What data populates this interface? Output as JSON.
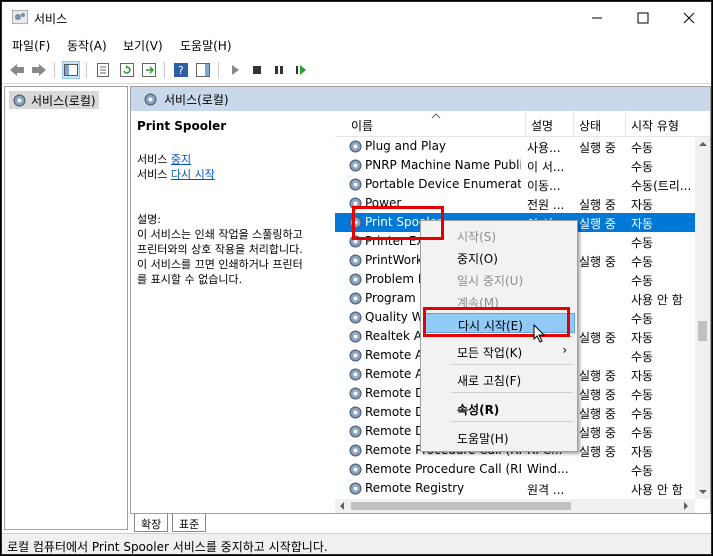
{
  "window": {
    "title": "서비스"
  },
  "menu": [
    "파일(F)",
    "동작(A)",
    "보기(V)",
    "도움말(H)"
  ],
  "tree": {
    "root": "서비스(로컬)"
  },
  "main": {
    "header": "서비스(로컬)",
    "service_name": "Print Spooler",
    "stop_prefix": "서비스 ",
    "stop_link": "중지",
    "restart_prefix": "서비스 ",
    "restart_link": "다시 시작",
    "desc_label": "설명:",
    "desc_lines": [
      "이 서비스는 인쇄 작업을 스풀링하고",
      "프린터와의 상호 작용을 처리합니다.",
      "이 서비스를 끄면 인쇄하거나 프린터",
      "를 표시할 수 없습니다."
    ]
  },
  "columns": {
    "name": "이름",
    "desc": "설명",
    "status": "상태",
    "startup": "시작 유형"
  },
  "rows": [
    {
      "name": "Plug and Play",
      "desc": "사용...",
      "status": "실행 중",
      "startup": "수동"
    },
    {
      "name": "PNRP Machine Name Publi...",
      "desc": "이 서...",
      "status": "",
      "startup": "수동"
    },
    {
      "name": "Portable Device Enumerato...",
      "desc": "이동...",
      "status": "",
      "startup": "수동(트리..."
    },
    {
      "name": "Power",
      "desc": "전원 ...",
      "status": "실행 중",
      "startup": "자동"
    },
    {
      "name": "Print Spooler",
      "desc": "이 서...",
      "status": "실행 중",
      "startup": "자동"
    },
    {
      "name": "Printer Extensions and N...",
      "desc": "",
      "status": "",
      "startup": "수동"
    },
    {
      "name": "PrintWorkflow",
      "desc": "",
      "status": "실행 중",
      "startup": "수동"
    },
    {
      "name": "Problem Reports Control...",
      "desc": "",
      "status": "",
      "startup": "수동"
    },
    {
      "name": "Program Compatibility...",
      "desc": "",
      "status": "",
      "startup": "사용 안 함"
    },
    {
      "name": "Quality Windows Audio...",
      "desc": "",
      "status": "",
      "startup": "수동"
    },
    {
      "name": "Realtek Audio Universal...",
      "desc": "",
      "status": "실행 중",
      "startup": "자동"
    },
    {
      "name": "Remote Access Auto...",
      "desc": "",
      "status": "",
      "startup": "수동"
    },
    {
      "name": "Remote Access Connect...",
      "desc": "",
      "status": "실행 중",
      "startup": "자동"
    },
    {
      "name": "Remote Desktop Config...",
      "desc": "",
      "status": "실행 중",
      "startup": "수동"
    },
    {
      "name": "Remote Desktop Services",
      "desc": "",
      "status": "실행 중",
      "startup": "수동"
    },
    {
      "name": "Remote Desktop Services...",
      "desc": "",
      "status": "실행 중",
      "startup": "수동"
    },
    {
      "name": "Remote Procedure Call (RP...",
      "desc": "RPC...",
      "status": "실행 중",
      "startup": "자동"
    },
    {
      "name": "Remote Procedure Call (RP...",
      "desc": "Wind...",
      "status": "",
      "startup": "수동"
    },
    {
      "name": "Remote Registry",
      "desc": "원격 ...",
      "status": "",
      "startup": "사용 안 함"
    }
  ],
  "context_menu": {
    "start": "시작(S)",
    "stop": "중지(O)",
    "pause": "일시 중지(U)",
    "resume": "계속(M)",
    "restart": "다시 시작(E)",
    "all_tasks": "모든 작업(K)",
    "refresh": "새로 고침(F)",
    "properties": "속성(R)",
    "help": "도움말(H)"
  },
  "tabs": [
    "확장",
    "표준"
  ],
  "statusbar": "로컬 컴퓨터에서 Print Spooler 서비스를 중지하고 시작합니다.",
  "colors": {
    "selection": "#0078d7",
    "highlight_box": "#e60000",
    "menu_hover": "#91c9f7"
  }
}
